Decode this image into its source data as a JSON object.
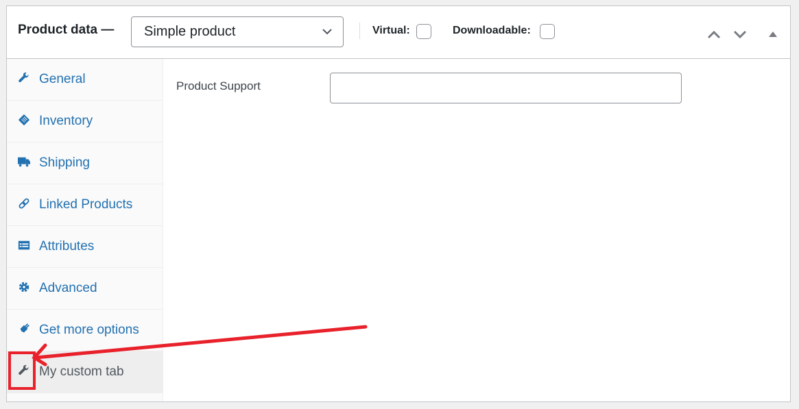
{
  "header": {
    "title": "Product data —",
    "product_type": {
      "selected": "Simple product"
    },
    "virtual_label": "Virtual:",
    "virtual_checked": false,
    "downloadable_label": "Downloadable:",
    "downloadable_checked": false,
    "controls": [
      "move-up-icon",
      "move-down-icon",
      "toggle-panel-icon"
    ]
  },
  "sidebar": {
    "items": [
      {
        "label": "General",
        "icon": "wrench-icon"
      },
      {
        "label": "Inventory",
        "icon": "clipboard-icon"
      },
      {
        "label": "Shipping",
        "icon": "truck-icon"
      },
      {
        "label": "Linked Products",
        "icon": "link-icon"
      },
      {
        "label": "Attributes",
        "icon": "list-icon"
      },
      {
        "label": "Advanced",
        "icon": "gear-icon"
      },
      {
        "label": "Get more options",
        "icon": "plug-icon"
      },
      {
        "label": "My custom tab",
        "icon": "wrench-icon",
        "active": true
      }
    ]
  },
  "content": {
    "field_label": "Product Support",
    "field_value": "",
    "field_placeholder": ""
  },
  "colors": {
    "link": "#2271b1",
    "annotation": "#e8212b"
  }
}
